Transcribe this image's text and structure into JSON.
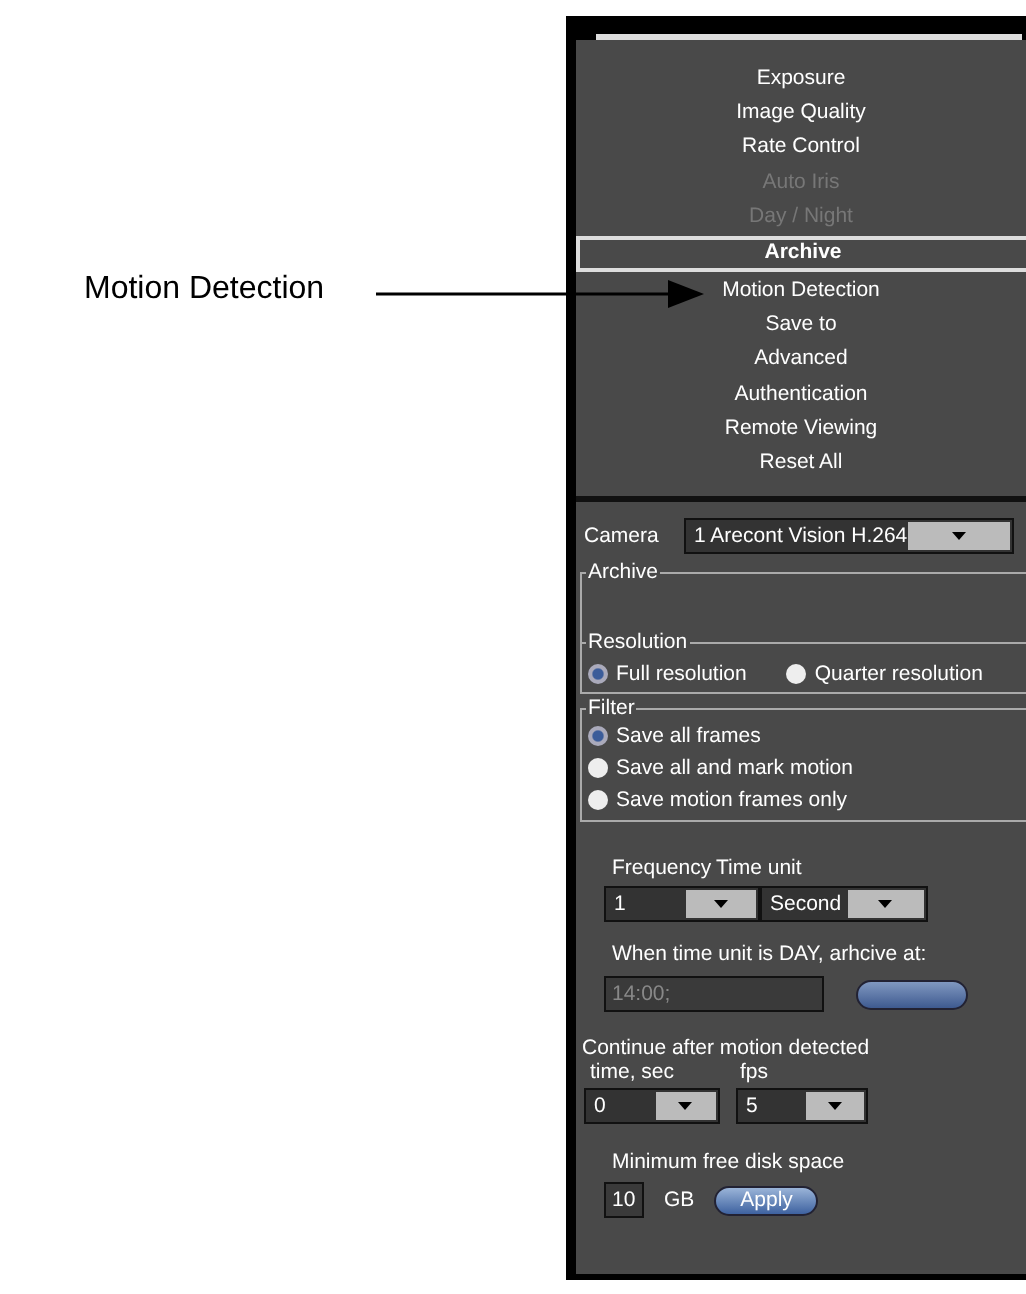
{
  "callout": {
    "label": "Motion Detection"
  },
  "menu": [
    {
      "label": "Exposure",
      "disabled": false,
      "selected": false
    },
    {
      "label": "Image Quality",
      "disabled": false,
      "selected": false
    },
    {
      "label": "Rate Control",
      "disabled": false,
      "selected": false
    },
    {
      "label": "Auto Iris",
      "disabled": true,
      "selected": false
    },
    {
      "label": "Day / Night",
      "disabled": true,
      "selected": false
    },
    {
      "label": "Archive",
      "disabled": false,
      "selected": true
    },
    {
      "label": "Motion Detection",
      "disabled": false,
      "selected": false
    },
    {
      "label": "Save to",
      "disabled": false,
      "selected": false
    },
    {
      "label": "Advanced",
      "disabled": false,
      "selected": false
    },
    {
      "label": "Authentication",
      "disabled": false,
      "selected": false
    },
    {
      "label": "Remote Viewing",
      "disabled": false,
      "selected": false
    },
    {
      "label": "Reset All",
      "disabled": false,
      "selected": false
    }
  ],
  "camera": {
    "label": "Camera",
    "value": "1 Arecont Vision H.264"
  },
  "archive": {
    "title": "Archive",
    "resolution": {
      "title": "Resolution",
      "options": [
        {
          "label": "Full resolution",
          "selected": true
        },
        {
          "label": "Quarter resolution",
          "selected": false
        }
      ]
    },
    "filter": {
      "title": "Filter",
      "options": [
        {
          "label": "Save all frames",
          "selected": true
        },
        {
          "label": "Save all and mark motion",
          "selected": false
        },
        {
          "label": "Save motion frames only",
          "selected": false
        }
      ]
    },
    "frequency": {
      "label": "Frequency",
      "value": "1"
    },
    "time_unit": {
      "label": "Time unit",
      "value": "Second"
    },
    "day_note": "When time unit is DAY, arhcive at:",
    "day_time": {
      "value": "14:00;",
      "disabled": true
    },
    "day_button": {
      "disabled": true
    },
    "continue_label": "Continue after motion detected",
    "time_sec": {
      "label": "time, sec",
      "value": "0"
    },
    "fps": {
      "label": "fps",
      "value": "5"
    },
    "disk_label": "Minimum free disk space",
    "disk_value": "10",
    "disk_unit": "GB",
    "apply": "Apply"
  }
}
